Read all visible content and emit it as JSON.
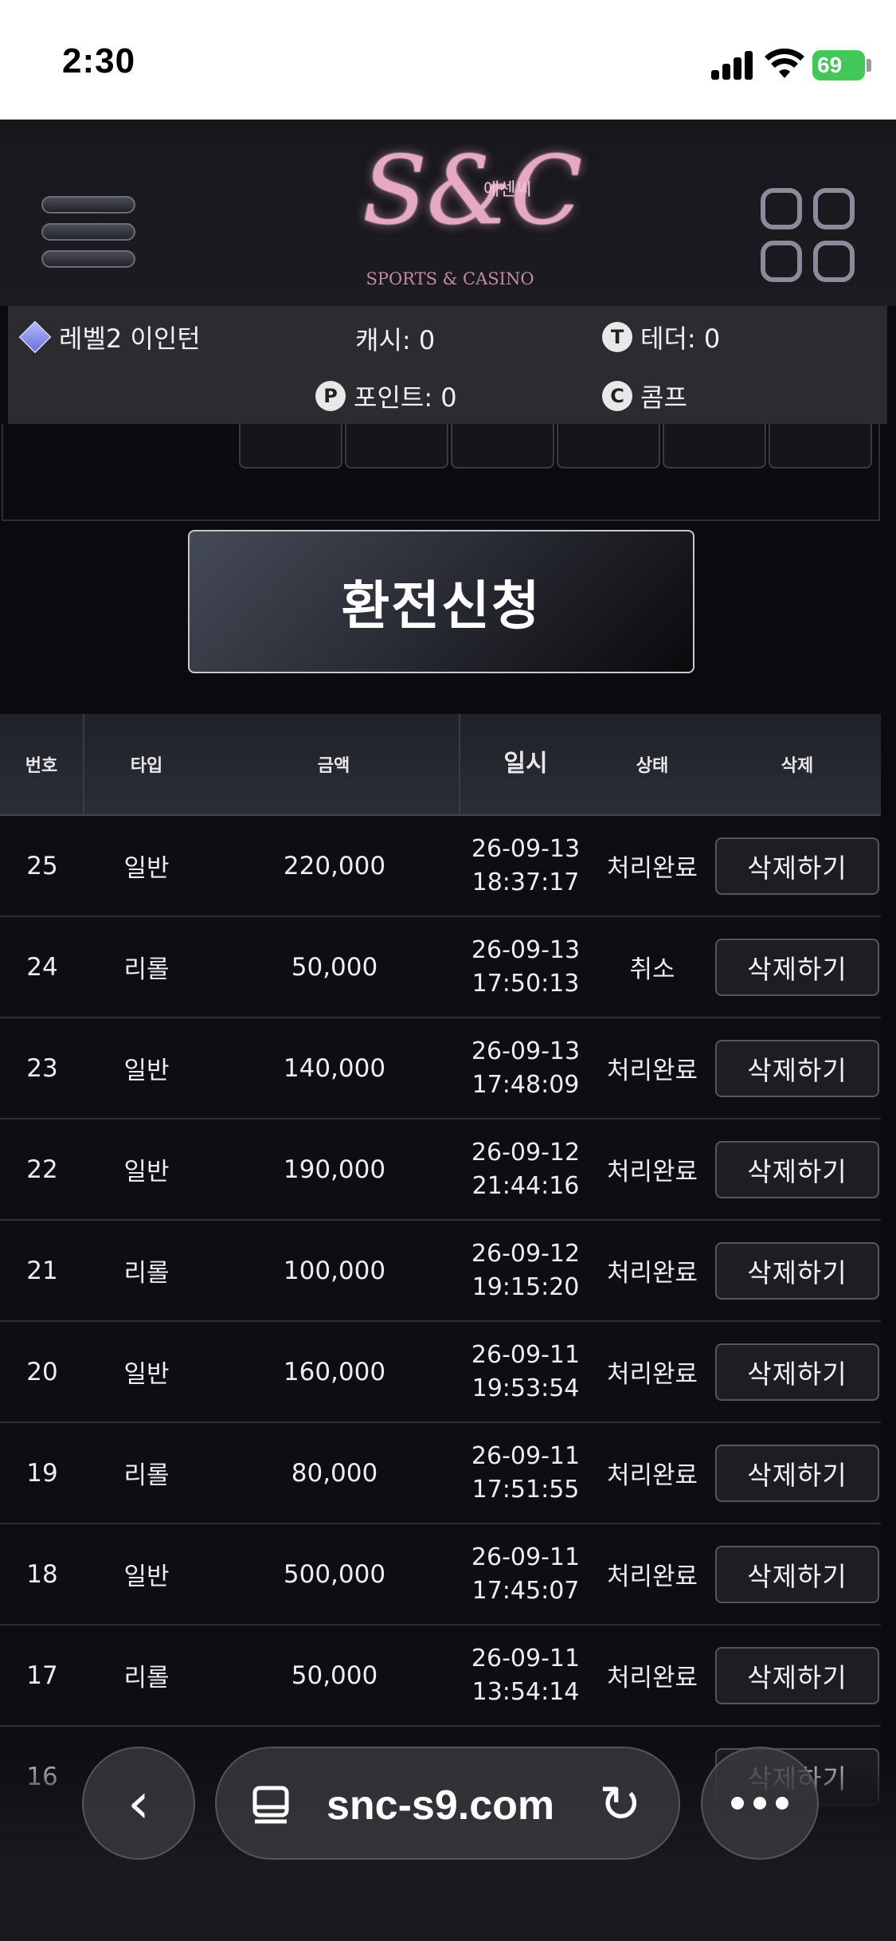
{
  "status_bar": {
    "time": "2:30",
    "battery": "69"
  },
  "brand": {
    "logo_mark": "S&C",
    "logo_korean": "에센씨",
    "logo_subtitle": "SPORTS & CASINO"
  },
  "info": {
    "level": "레벨2 이인턴",
    "cash": "캐시: 0",
    "tether": "테더: 0",
    "point": "포인트: 0",
    "comp": "콤프",
    "tether_badge": "T",
    "point_badge": "P",
    "comp_badge": "C"
  },
  "exchange_button": "환전신청",
  "table": {
    "headers": [
      "번호",
      "타입",
      "금액",
      "일시",
      "상태",
      "삭제"
    ],
    "delete_label": "삭제하기",
    "rows": [
      {
        "no": "25",
        "type": "일반",
        "amount": "220,000",
        "date": "26-09-13",
        "time": "18:37:17",
        "status": "처리완료"
      },
      {
        "no": "24",
        "type": "리롤",
        "amount": "50,000",
        "date": "26-09-13",
        "time": "17:50:13",
        "status": "취소"
      },
      {
        "no": "23",
        "type": "일반",
        "amount": "140,000",
        "date": "26-09-13",
        "time": "17:48:09",
        "status": "처리완료"
      },
      {
        "no": "22",
        "type": "일반",
        "amount": "190,000",
        "date": "26-09-12",
        "time": "21:44:16",
        "status": "처리완료"
      },
      {
        "no": "21",
        "type": "리롤",
        "amount": "100,000",
        "date": "26-09-12",
        "time": "19:15:20",
        "status": "처리완료"
      },
      {
        "no": "20",
        "type": "일반",
        "amount": "160,000",
        "date": "26-09-11",
        "time": "19:53:54",
        "status": "처리완료"
      },
      {
        "no": "19",
        "type": "리롤",
        "amount": "80,000",
        "date": "26-09-11",
        "time": "17:51:55",
        "status": "처리완료"
      },
      {
        "no": "18",
        "type": "일반",
        "amount": "500,000",
        "date": "26-09-11",
        "time": "17:45:07",
        "status": "처리완료"
      },
      {
        "no": "17",
        "type": "리롤",
        "amount": "50,000",
        "date": "26-09-11",
        "time": "13:54:14",
        "status": "처리완료"
      },
      {
        "no": "16",
        "type": "",
        "amount": "",
        "date": "",
        "time": "",
        "status": ""
      }
    ]
  },
  "browser": {
    "url": "snc-s9.com"
  },
  "colors": {
    "page_bg": "#0b0b0f",
    "info_bar": "#2c2c30",
    "battery": "#43c759",
    "logo": "#e6a9c0"
  }
}
